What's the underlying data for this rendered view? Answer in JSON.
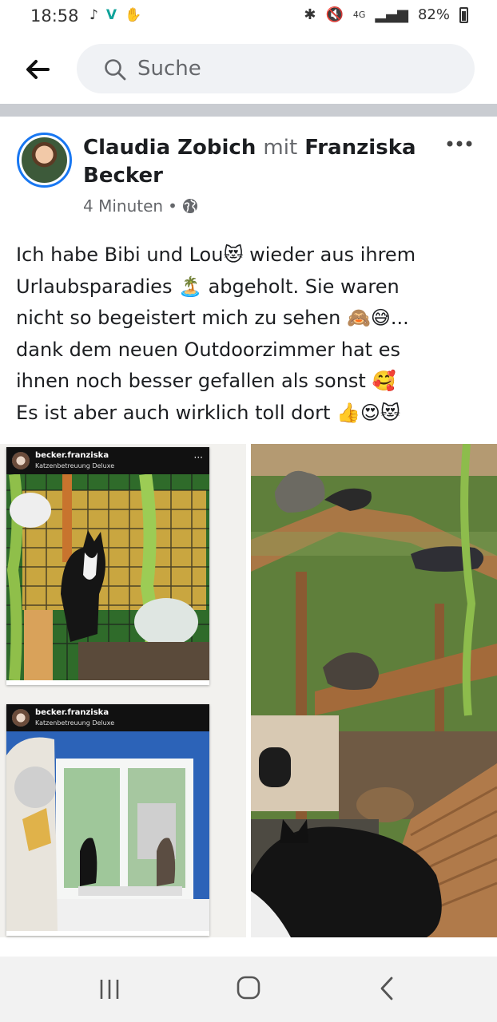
{
  "status_bar": {
    "time": "18:58",
    "app_icons": [
      "tiktok-icon",
      "v-icon",
      "hand-icon"
    ],
    "battery": "82%",
    "network": "4G",
    "icons": [
      "bluetooth-icon",
      "mute-icon",
      "signal-icon",
      "battery-icon"
    ]
  },
  "header": {
    "search_placeholder": "Suche"
  },
  "post": {
    "author": "Claudia Zobich",
    "with_word": "mit",
    "tagged": "Franziska Becker",
    "time": "4 Minuten",
    "separator": "•",
    "text_lines": [
      "Ich habe Bibi und Lou😻 wieder aus ihrem",
      "Urlaubsparadies 🏝️ abgeholt. Sie waren",
      "nicht so begeistert mich zu sehen 🙈😅...",
      "dank dem neuen Outdoorzimmer hat es",
      "ihnen noch besser gefallen als sonst 🥰",
      "Es ist aber auch wirklich toll dort 👍😍😻"
    ],
    "embeds": [
      {
        "username": "becker.franziska",
        "subtitle": "Katzenbetreuung Deluxe",
        "more": "···"
      },
      {
        "username": "becker.franziska",
        "subtitle": "Katzenbetreuung Deluxe",
        "more": "···"
      }
    ]
  },
  "colors": {
    "accent": "#1877f2",
    "text": "#1c1e21",
    "secondary_text": "#65676b",
    "divider": "#c9ccd1"
  }
}
